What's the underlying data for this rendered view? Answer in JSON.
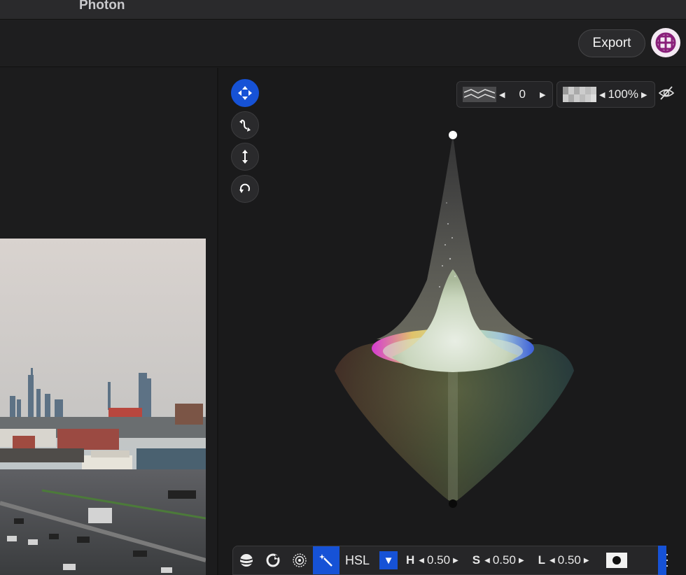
{
  "app": {
    "title": "Photon"
  },
  "toolbar": {
    "export_label": "Export"
  },
  "tools": [
    {
      "name": "move-tool",
      "icon": "move-arrows-icon",
      "active": true
    },
    {
      "name": "curve-tool",
      "icon": "curve-path-icon",
      "active": false
    },
    {
      "name": "vertical-tool",
      "icon": "vertical-arrows-icon",
      "active": false
    },
    {
      "name": "rotate-tool",
      "icon": "rotate-icon",
      "active": false
    }
  ],
  "viewer_controls": {
    "layer_value": "0",
    "opacity_value": "100%"
  },
  "bottom": {
    "mode_label": "HSL",
    "h_key": "H",
    "h_value": "0.50",
    "s_key": "S",
    "s_value": "0.50",
    "l_key": "L",
    "l_value": "0.50"
  },
  "colors": {
    "accent": "#1652d6",
    "background": "#1a1a1b"
  }
}
